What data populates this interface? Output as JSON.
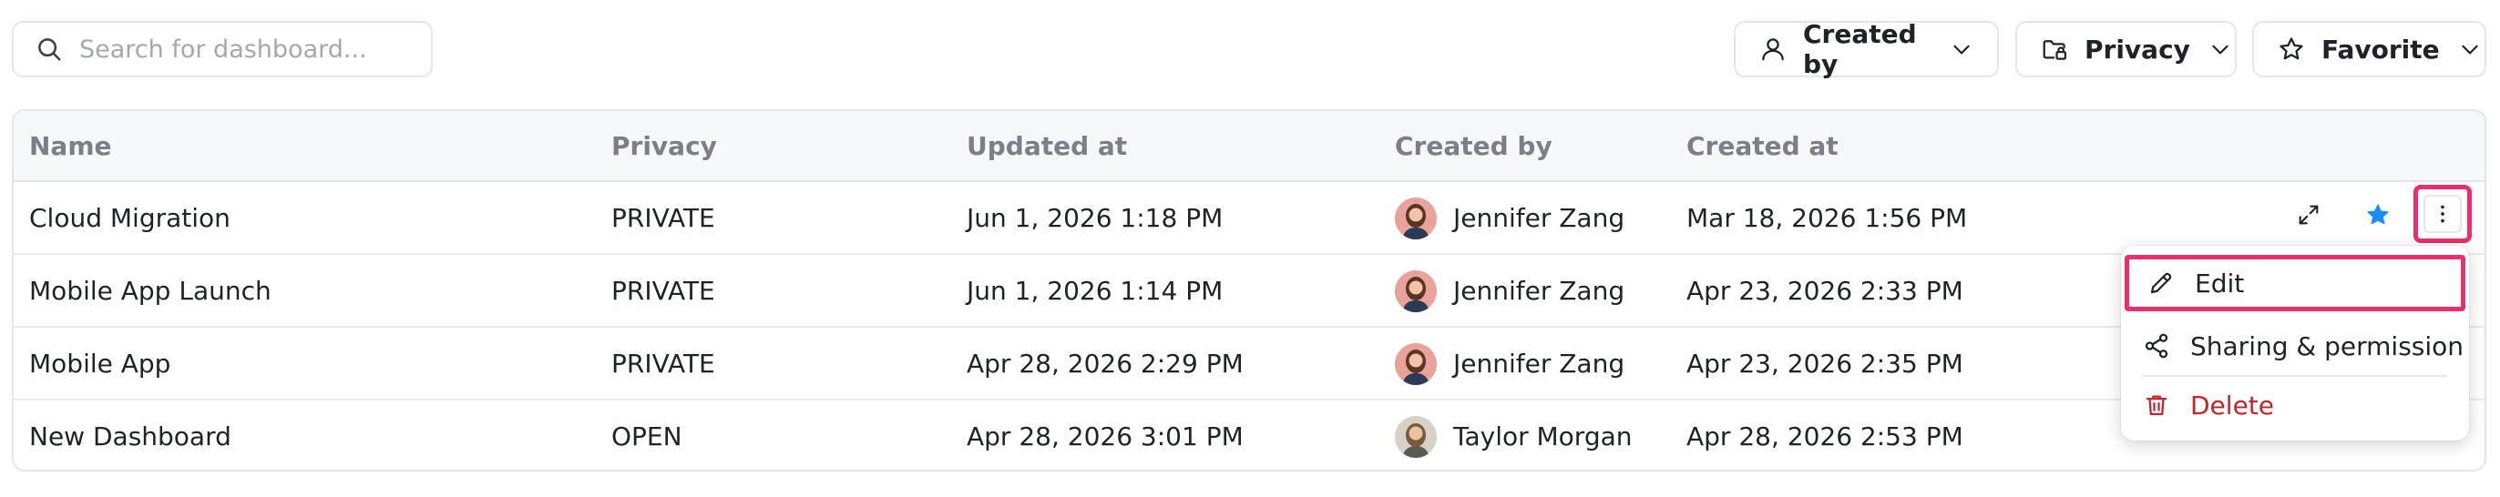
{
  "toolbar": {
    "search_placeholder": "Search for dashboard...",
    "filters": {
      "created_by": "Created by",
      "privacy": "Privacy",
      "favorite": "Favorite"
    }
  },
  "table": {
    "columns": {
      "name": "Name",
      "privacy": "Privacy",
      "updated_at": "Updated at",
      "created_by": "Created by",
      "created_at": "Created at"
    },
    "rows": [
      {
        "name": "Cloud Migration",
        "privacy": "PRIVATE",
        "updated_at": "Jun 1, 2026 1:18 PM",
        "created_by": "Jennifer Zang",
        "created_at": "Mar 18, 2026 1:56 PM"
      },
      {
        "name": "Mobile App Launch",
        "privacy": "PRIVATE",
        "updated_at": "Jun 1, 2026 1:14 PM",
        "created_by": "Jennifer Zang",
        "created_at": "Apr 23, 2026 2:33 PM"
      },
      {
        "name": "Mobile App",
        "privacy": "PRIVATE",
        "updated_at": "Apr 28, 2026 2:29 PM",
        "created_by": "Jennifer Zang",
        "created_at": "Apr 23, 2026 2:35 PM"
      },
      {
        "name": "New Dashboard",
        "privacy": "OPEN",
        "updated_at": "Apr 28, 2026 3:01 PM",
        "created_by": "Taylor Morgan",
        "created_at": "Apr 28, 2026 2:53 PM"
      }
    ]
  },
  "context_menu": {
    "edit": "Edit",
    "share": "Sharing & permission",
    "delete": "Delete"
  },
  "colors": {
    "highlight": "#ea2f6b",
    "favorite_star": "#1a8cff",
    "danger": "#c0272d"
  },
  "icons": [
    "search-icon",
    "user-icon",
    "folder-lock-icon",
    "star-outline-icon",
    "chevron-down-icon",
    "expand-icon",
    "star-filled-icon",
    "more-vertical-icon",
    "pencil-icon",
    "share-icon",
    "trash-icon"
  ]
}
